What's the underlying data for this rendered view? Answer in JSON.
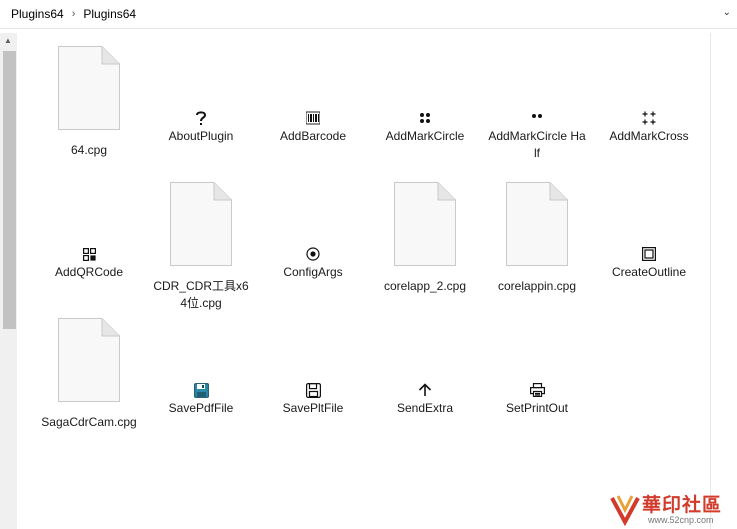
{
  "breadcrumb": {
    "items": [
      "Plugins64",
      "Plugins64"
    ]
  },
  "files": [
    {
      "label": "64.cpg",
      "icon": "document-icon"
    },
    {
      "label": "AboutPlugin",
      "icon": "question-icon"
    },
    {
      "label": "AddBarcode",
      "icon": "barcode-icon"
    },
    {
      "label": "AddMarkCircle",
      "icon": "four-dots-icon"
    },
    {
      "label": "AddMarkCircle Half",
      "icon": "two-dots-icon"
    },
    {
      "label": "AddMarkCross",
      "icon": "crosses-icon"
    },
    {
      "label": "AddQRCode",
      "icon": "qr-code-icon"
    },
    {
      "label": "CDR_CDR工具x64位.cpg",
      "icon": "document-icon"
    },
    {
      "label": "ConfigArgs",
      "icon": "target-icon"
    },
    {
      "label": "corelapp_2.cpg",
      "icon": "document-icon"
    },
    {
      "label": "corelappin.cpg",
      "icon": "document-icon"
    },
    {
      "label": "CreateOutline",
      "icon": "outline-square-icon"
    },
    {
      "label": "SagaCdrCam.cpg",
      "icon": "document-icon"
    },
    {
      "label": "SavePdfFile",
      "icon": "floppy-color-icon"
    },
    {
      "label": "SavePltFile",
      "icon": "floppy-icon"
    },
    {
      "label": "SendExtra",
      "icon": "arrow-up-icon"
    },
    {
      "label": "SetPrintOut",
      "icon": "printer-icon"
    }
  ],
  "watermark": {
    "text": "華印社區",
    "url": "www.52cnp.com"
  }
}
